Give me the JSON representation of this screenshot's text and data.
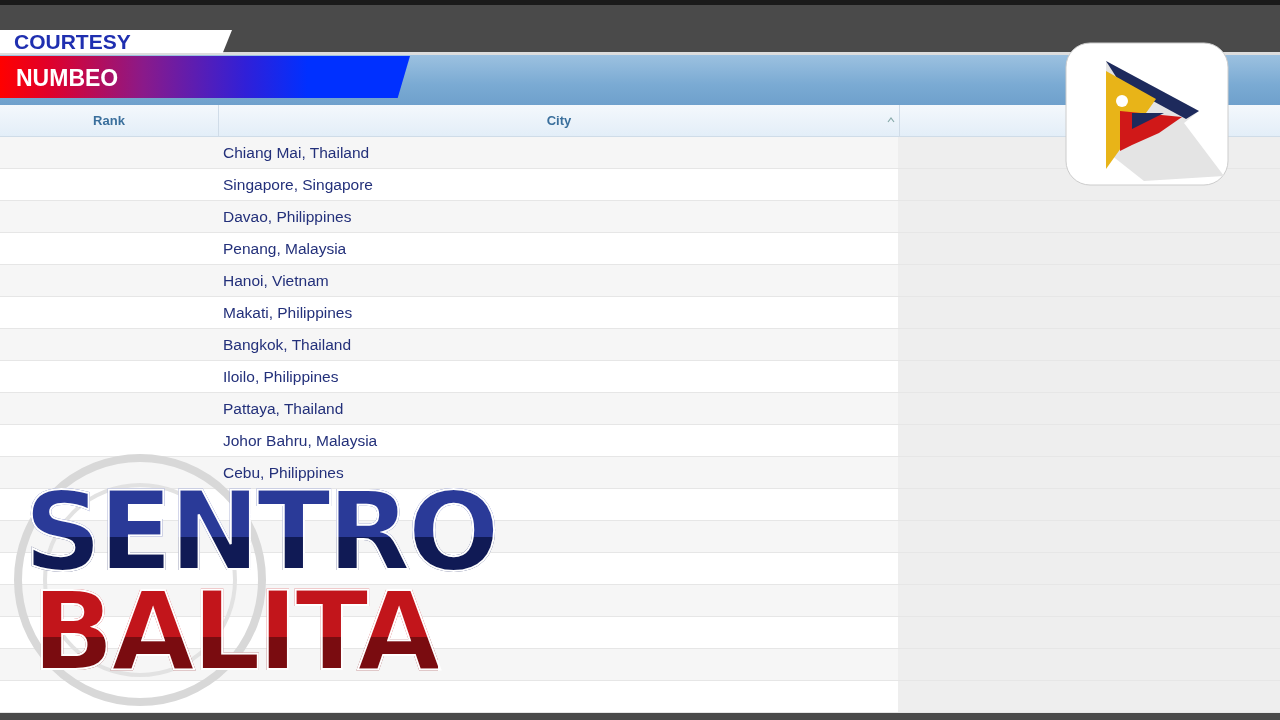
{
  "credit": {
    "label": "COURTESY",
    "source": "NUMBEO"
  },
  "table": {
    "columns": [
      "Rank",
      "City"
    ],
    "rows": [
      {
        "city": "Chiang Mai, Thailand"
      },
      {
        "city": "Singapore, Singapore"
      },
      {
        "city": "Davao, Philippines"
      },
      {
        "city": "Penang, Malaysia"
      },
      {
        "city": "Hanoi, Vietnam"
      },
      {
        "city": "Makati, Philippines"
      },
      {
        "city": "Bangkok, Thailand"
      },
      {
        "city": "Iloilo, Philippines"
      },
      {
        "city": "Pattaya, Thailand"
      },
      {
        "city": "Johor Bahru, Malaysia"
      },
      {
        "city": "Cebu, Philippines"
      }
    ]
  },
  "show_title": [
    "SENTRO",
    "BALITA"
  ]
}
